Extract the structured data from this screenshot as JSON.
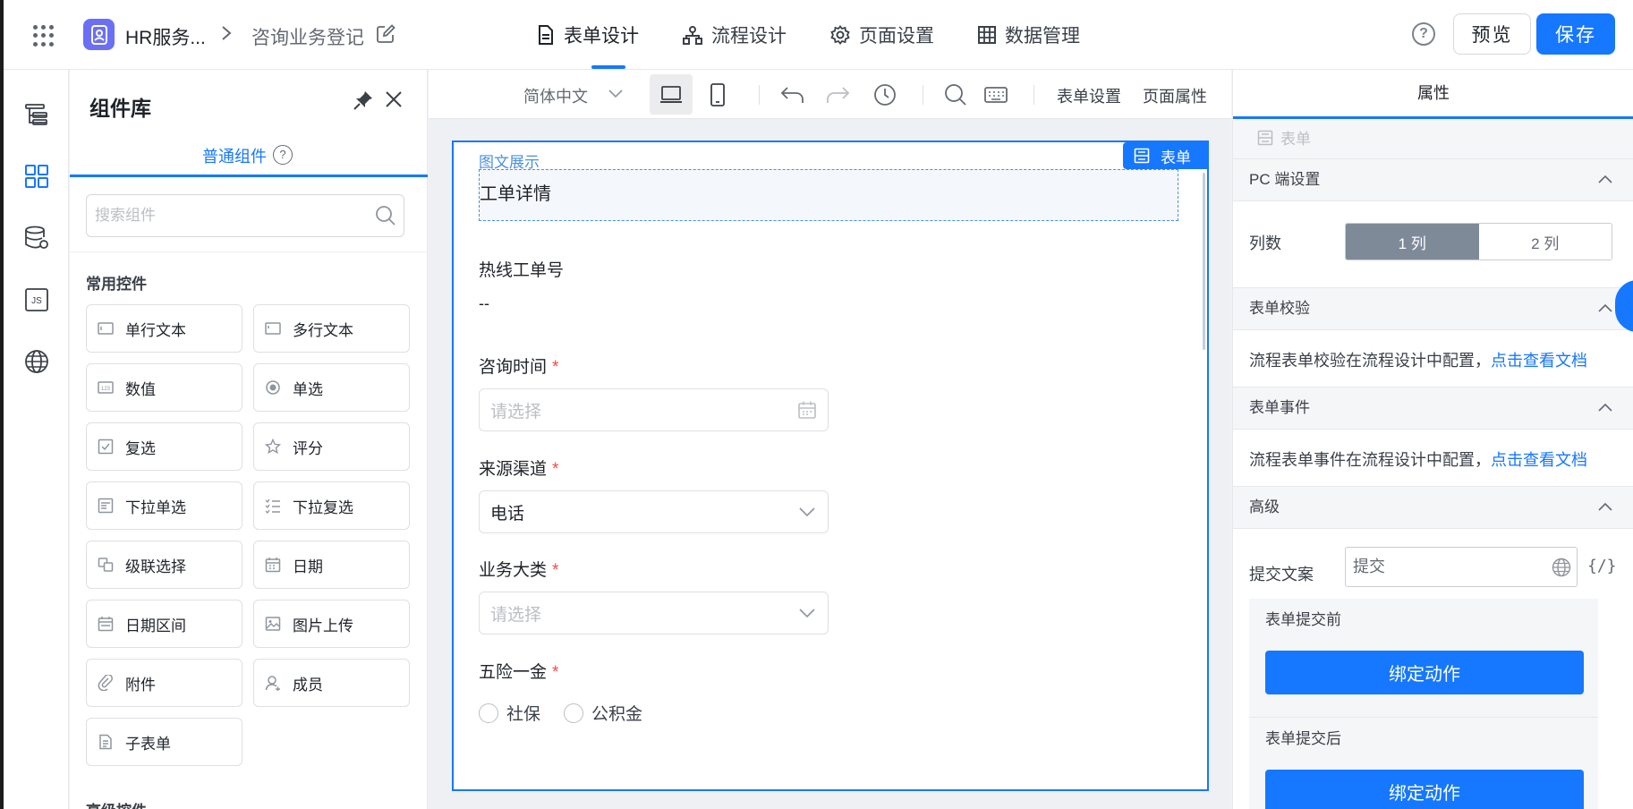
{
  "topbar": {
    "app_name": "HR服务...",
    "breadcrumb_sep": ">",
    "page_name": "咨询业务登记",
    "tabs": [
      {
        "label": "表单设计",
        "icon": "document-icon"
      },
      {
        "label": "流程设计",
        "icon": "flow-icon"
      },
      {
        "label": "页面设置",
        "icon": "gear-icon"
      },
      {
        "label": "数据管理",
        "icon": "table-icon"
      }
    ],
    "help": "?",
    "preview_label": "预览",
    "save_label": "保存"
  },
  "component_panel": {
    "title": "组件库",
    "tab_label": "普通组件",
    "tab_help": "?",
    "search_placeholder": "搜索组件",
    "section_common": "常用控件",
    "items": [
      {
        "label": "单行文本",
        "icon": "single-line-text-icon"
      },
      {
        "label": "多行文本",
        "icon": "multi-line-text-icon"
      },
      {
        "label": "数值",
        "icon": "number-icon"
      },
      {
        "label": "单选",
        "icon": "radio-icon"
      },
      {
        "label": "复选",
        "icon": "checkbox-icon"
      },
      {
        "label": "评分",
        "icon": "star-icon"
      },
      {
        "label": "下拉单选",
        "icon": "dropdown-single-icon"
      },
      {
        "label": "下拉复选",
        "icon": "dropdown-multi-icon"
      },
      {
        "label": "级联选择",
        "icon": "cascade-icon"
      },
      {
        "label": "日期",
        "icon": "calendar-icon"
      },
      {
        "label": "日期区间",
        "icon": "date-range-icon"
      },
      {
        "label": "图片上传",
        "icon": "image-upload-icon"
      },
      {
        "label": "附件",
        "icon": "attachment-icon"
      },
      {
        "label": "成员",
        "icon": "member-icon"
      },
      {
        "label": "子表单",
        "icon": "sub-form-icon"
      }
    ],
    "section_advanced": "高级控件"
  },
  "canvas_toolbar": {
    "language": "简体中文",
    "form_settings": "表单设置",
    "page_properties": "页面属性"
  },
  "form": {
    "badge": "表单",
    "picture_label": "图文展示",
    "picture_text": "工单详情",
    "fields": [
      {
        "label": "热线工单号",
        "required": "",
        "value": "--"
      },
      {
        "label": "咨询时间",
        "required": "*",
        "placeholder": "请选择"
      },
      {
        "label": "来源渠道",
        "required": "*",
        "value": "电话"
      },
      {
        "label": "业务大类",
        "required": "*",
        "placeholder": "请选择"
      },
      {
        "label": "五险一金",
        "required": "*",
        "options": [
          "社保",
          "公积金"
        ]
      }
    ]
  },
  "properties": {
    "header": "属性",
    "crumb": "表单",
    "pc_settings": {
      "title": "PC 端设置",
      "columns_label": "列数",
      "options": [
        "1 列",
        "2 列"
      ],
      "selected": "1 列"
    },
    "validation": {
      "title": "表单校验",
      "text": "流程表单校验在流程设计中配置，",
      "link": "点击查看文档"
    },
    "events": {
      "title": "表单事件",
      "text": "流程表单事件在流程设计中配置，",
      "link": "点击查看文档"
    },
    "advanced": {
      "title": "高级",
      "submit_label": "提交文案",
      "submit_value": "提交",
      "expr": "{/}",
      "before_submit": "表单提交前",
      "after_submit": "表单提交后",
      "bind_action": "绑定动作"
    }
  },
  "colors": {
    "primary": "#1677ff",
    "required": "#f54a45",
    "logo": "#6b6ff5"
  }
}
